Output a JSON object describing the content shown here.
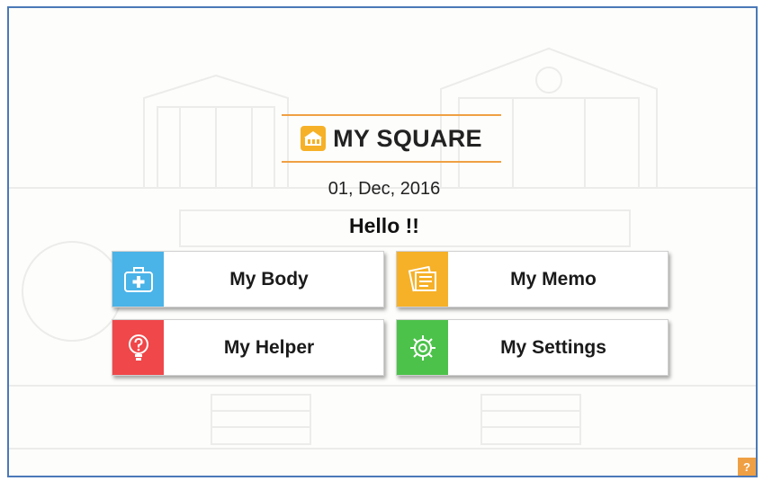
{
  "app": {
    "title": "MY SQUARE",
    "logo_icon": "building-icon"
  },
  "date": "01, Dec, 2016",
  "greeting": "Hello !!",
  "menu": [
    {
      "label": "My Body",
      "icon": "first-aid-kit-icon",
      "color": "#4ab3e8"
    },
    {
      "label": "My Memo",
      "icon": "memo-notes-icon",
      "color": "#f6b128"
    },
    {
      "label": "My Helper",
      "icon": "lightbulb-icon",
      "color": "#f0474a"
    },
    {
      "label": "My Settings",
      "icon": "gear-icon",
      "color": "#4cc24a"
    }
  ],
  "help": {
    "label": "?"
  },
  "colors": {
    "accent": "#f0a044",
    "frame": "#4b79b8"
  }
}
